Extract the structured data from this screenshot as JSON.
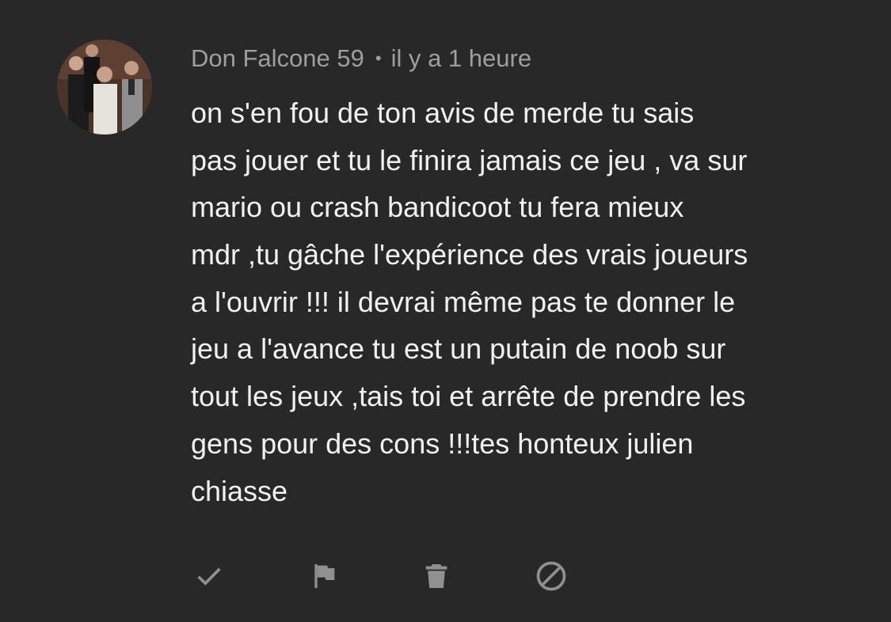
{
  "comment": {
    "author": "Don Falcone 59",
    "separator": "•",
    "timestamp": "il y a 1 heure",
    "body_lines": [
      "on s'en fou de ton avis de merde tu sais",
      "pas jouer et tu le finira jamais ce jeu , va sur",
      "mario ou crash bandicoot tu fera mieux",
      "mdr ,tu gâche l'expérience des vrais joueurs",
      "a l'ouvrir !!! il devrai même pas te donner le",
      "jeu a l'avance tu est un putain de noob sur",
      "tout les jeux ,tais toi et arrête de prendre les",
      "gens pour des cons !!!tes honteux julien",
      "chiasse"
    ]
  },
  "actions": [
    {
      "icon": "checkmark-icon",
      "name": "approve-button"
    },
    {
      "icon": "flag-icon",
      "name": "report-button"
    },
    {
      "icon": "trash-icon",
      "name": "delete-button"
    },
    {
      "icon": "block-icon",
      "name": "block-button"
    }
  ],
  "colors": {
    "background": "#282828",
    "author_text": "#9e9e9e",
    "body_text": "#f1f1f1",
    "icon": "#909090"
  }
}
